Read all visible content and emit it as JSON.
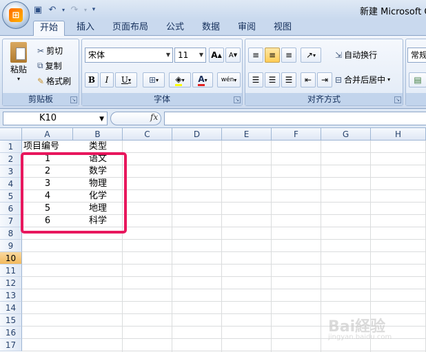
{
  "window": {
    "title": "新建 Microsoft O"
  },
  "quick_access": {
    "icons": [
      "save-icon",
      "undo-icon",
      "redo-icon",
      "customize-icon"
    ]
  },
  "tabs": [
    {
      "label": "开始",
      "active": true
    },
    {
      "label": "插入",
      "active": false
    },
    {
      "label": "页面布局",
      "active": false
    },
    {
      "label": "公式",
      "active": false
    },
    {
      "label": "数据",
      "active": false
    },
    {
      "label": "审阅",
      "active": false
    },
    {
      "label": "视图",
      "active": false
    }
  ],
  "ribbon": {
    "clipboard": {
      "label": "剪贴板",
      "paste": "粘贴",
      "cut": "剪切",
      "copy": "复制",
      "format_painter": "格式刷"
    },
    "font": {
      "label": "字体",
      "font_name": "宋体",
      "font_size": "11",
      "bold": "B",
      "italic": "I",
      "underline": "U",
      "grow": "A",
      "shrink": "A",
      "phonetic": "wén",
      "font_color_glyph": "A"
    },
    "alignment": {
      "label": "对齐方式",
      "wrap_text": "自动换行",
      "merge_center": "合并后居中"
    },
    "number": {
      "format": "常规"
    }
  },
  "formula_bar": {
    "name_box": "K10",
    "fx": "fx",
    "formula": ""
  },
  "sheet": {
    "columns": [
      "A",
      "B",
      "C",
      "D",
      "E",
      "F",
      "G",
      "H"
    ],
    "rows": [
      "1",
      "2",
      "3",
      "4",
      "5",
      "6",
      "7",
      "8",
      "9",
      "10",
      "11",
      "12",
      "13",
      "14",
      "15",
      "16",
      "17"
    ],
    "selected_row": "10",
    "cells": [
      {
        "ref": "A1",
        "text": "项目编号"
      },
      {
        "ref": "B1",
        "text": "类型"
      },
      {
        "ref": "A2",
        "text": "1"
      },
      {
        "ref": "B2",
        "text": "语文"
      },
      {
        "ref": "A3",
        "text": "2"
      },
      {
        "ref": "B3",
        "text": "数学"
      },
      {
        "ref": "A4",
        "text": "3"
      },
      {
        "ref": "B4",
        "text": "物理"
      },
      {
        "ref": "A5",
        "text": "4"
      },
      {
        "ref": "B5",
        "text": "化学"
      },
      {
        "ref": "A6",
        "text": "5"
      },
      {
        "ref": "B6",
        "text": "地理"
      },
      {
        "ref": "A7",
        "text": "6"
      },
      {
        "ref": "B7",
        "text": "科学"
      }
    ],
    "highlight_color": "#e8175d"
  },
  "watermark": {
    "text": "Bai経验",
    "sub": "jingyan.baidu.com"
  }
}
